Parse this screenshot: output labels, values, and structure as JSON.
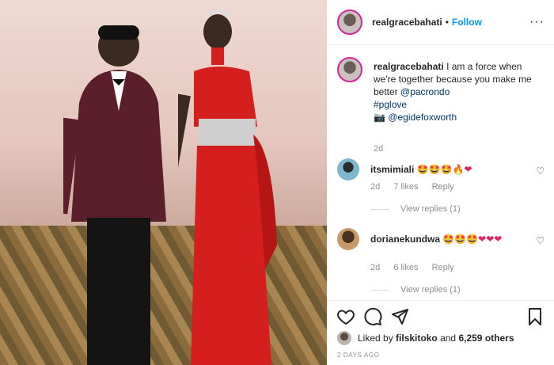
{
  "post": {
    "username": "realgracebahati",
    "follow_label": "Follow",
    "separator": "•",
    "more_label": "···"
  },
  "caption": {
    "username": "realgracebahati",
    "text": "I am a force when we're together because you make me better",
    "mention": "@pacrondo",
    "hashtag": "#pglove",
    "camera_icon": "camera-icon",
    "credit": "@egidefoxworth",
    "time": "2d"
  },
  "comments": [
    {
      "username": "itsmimiali",
      "text": "🤩🤩🤩🔥❤",
      "time": "2d",
      "likes": "7 likes",
      "reply_label": "Reply",
      "view_replies": "View replies (1)",
      "avatar_color": "#3a8fb7"
    },
    {
      "username": "dorianekundwa",
      "text": "🤩🤩🤩❤❤❤",
      "time": "2d",
      "likes": "6 likes",
      "reply_label": "Reply",
      "view_replies": "View replies (1)",
      "avatar_color": "#6b4a2e"
    }
  ],
  "actions": {
    "liked_by_prefix": "Liked by",
    "liked_by_user": "filskitoko",
    "liked_by_suffix": "and",
    "others": "6,259 others",
    "date": "2 DAYS AGO"
  },
  "colors": {
    "accent": "#0095f6",
    "text": "#262626",
    "muted": "#8e8e8e",
    "dress": "#d51f1f",
    "suit": "#5a1f2b"
  }
}
